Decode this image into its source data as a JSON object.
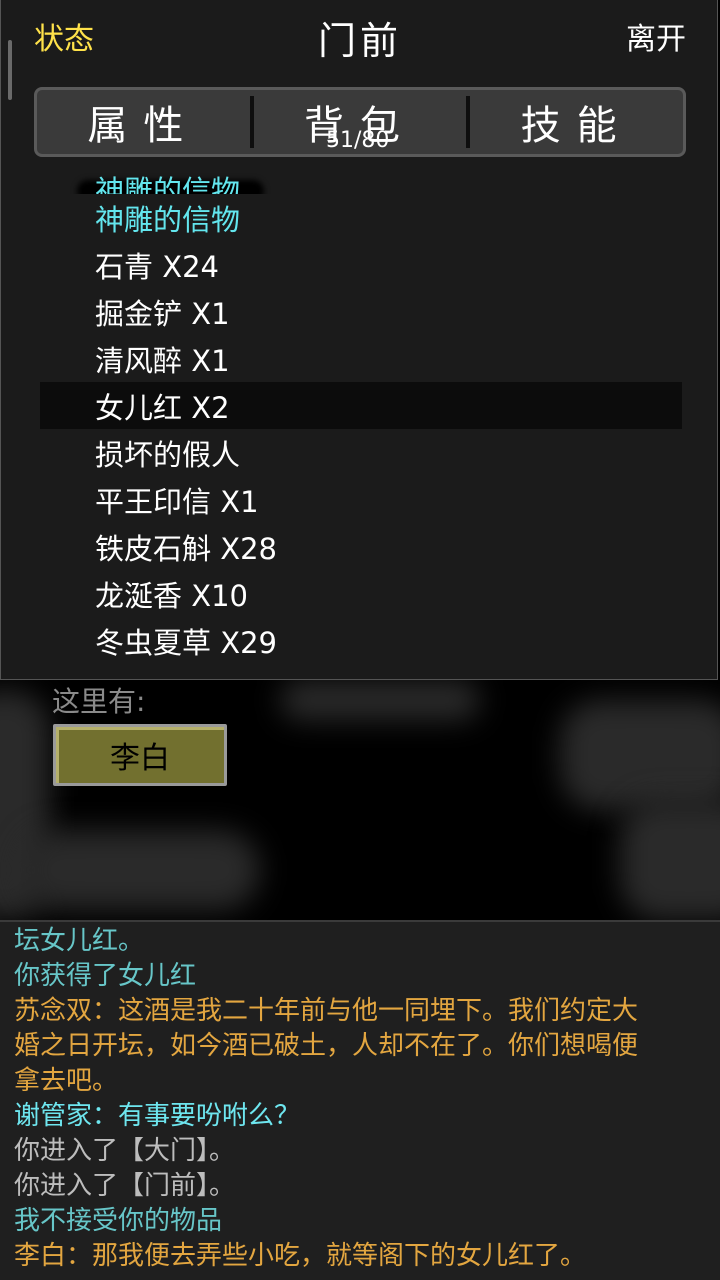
{
  "header": {
    "status_label": "状态",
    "title": "门前",
    "leave_label": "离开"
  },
  "tabs": [
    {
      "label": "属性"
    },
    {
      "label": "背包",
      "count": "51/80"
    },
    {
      "label": "技能"
    }
  ],
  "inventory": {
    "items": [
      {
        "label": "神雕的信物",
        "quest": true
      },
      {
        "label": "神雕的信物",
        "quest": true
      },
      {
        "label": "石青 X24"
      },
      {
        "label": "掘金铲 X1"
      },
      {
        "label": "清风醉 X1"
      },
      {
        "label": "女儿红 X2",
        "selected": true
      },
      {
        "label": "损坏的假人"
      },
      {
        "label": "平王印信 X1"
      },
      {
        "label": "铁皮石斛 X28"
      },
      {
        "label": "龙涎香 X10"
      },
      {
        "label": "冬虫夏草 X29"
      }
    ]
  },
  "scene": {
    "here_label": "这里有:",
    "npc_name": "李白"
  },
  "log": [
    {
      "text": "坛女儿红。",
      "color": "teal"
    },
    {
      "text": "你获得了女儿红",
      "color": "teal"
    },
    {
      "text": "苏念双：这酒是我二十年前与他一同埋下。我们约定大",
      "color": "orange"
    },
    {
      "text": "婚之日开坛，如今酒已破土，人却不在了。你们想喝便",
      "color": "orange"
    },
    {
      "text": "拿去吧。",
      "color": "orange"
    },
    {
      "text": "谢管家：有事要吩咐么？",
      "color": "cyan"
    },
    {
      "text": "你进入了【大门】。",
      "color": "gray"
    },
    {
      "text": "你进入了【门前】。",
      "color": "gray"
    },
    {
      "text": "我不接受你的物品",
      "color": "teal"
    },
    {
      "text": "李白：那我便去弄些小吃，就等阁下的女儿红了。",
      "color": "orange"
    }
  ]
}
